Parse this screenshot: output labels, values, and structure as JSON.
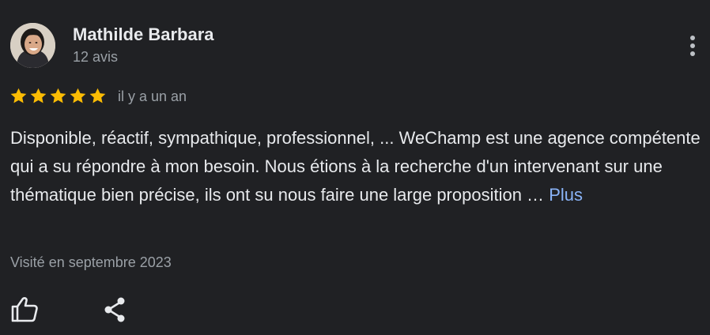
{
  "review": {
    "author": "Mathilde Barbara",
    "review_count": "12 avis",
    "rating": 5,
    "rating_max": 5,
    "date": "il y a un an",
    "text": "Disponible, réactif, sympathique, professionnel, ... WeChamp est une agence compétente qui a su répondre à mon besoin. Nous étions à la recherche d'un intervenant sur une thématique bien précise, ils ont su nous faire une large proposition … ",
    "more_label": "Plus",
    "visit": "Visité en septembre 2023"
  },
  "icons": {
    "avatar": "profile-photo",
    "menu": "more-vertical-icon",
    "star": "star-icon",
    "like": "thumbs-up-icon",
    "share": "share-icon"
  },
  "colors": {
    "background": "#202124",
    "star": "#fbbc04",
    "link": "#8ab4f8",
    "secondary_text": "#9aa0a6",
    "primary_text": "#e8eaed"
  }
}
